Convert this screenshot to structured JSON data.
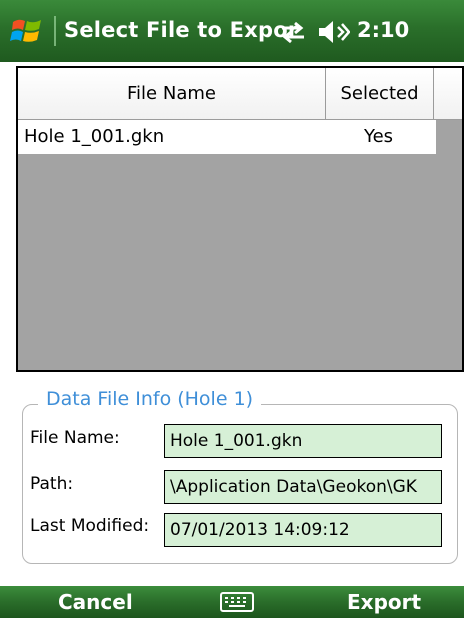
{
  "titlebar": {
    "title": "Select File to Expor",
    "time": "2:10",
    "icons": [
      "windows-start-icon",
      "connectivity-icon",
      "volume-icon"
    ]
  },
  "grid": {
    "columns": [
      "File Name",
      "Selected"
    ],
    "rows": [
      {
        "file_name": "Hole 1_001.gkn",
        "selected": "Yes"
      }
    ]
  },
  "info": {
    "title": "Data File Info (Hole 1)",
    "file_name_label": "File Name:",
    "file_name_value": "Hole 1_001.gkn",
    "path_label": "Path:",
    "path_value": "\\Application Data\\Geokon\\GK",
    "modified_label": "Last Modified:",
    "modified_value": "07/01/2013  14:09:12"
  },
  "softkeys": {
    "left": "Cancel",
    "right": "Export",
    "center_icon": "keyboard-icon"
  },
  "colors": {
    "title_bar": "#2a6f2a",
    "group_title": "#3f8fd8",
    "field_bg": "#d6f0d6",
    "grid_empty": "#a3a3a3"
  }
}
